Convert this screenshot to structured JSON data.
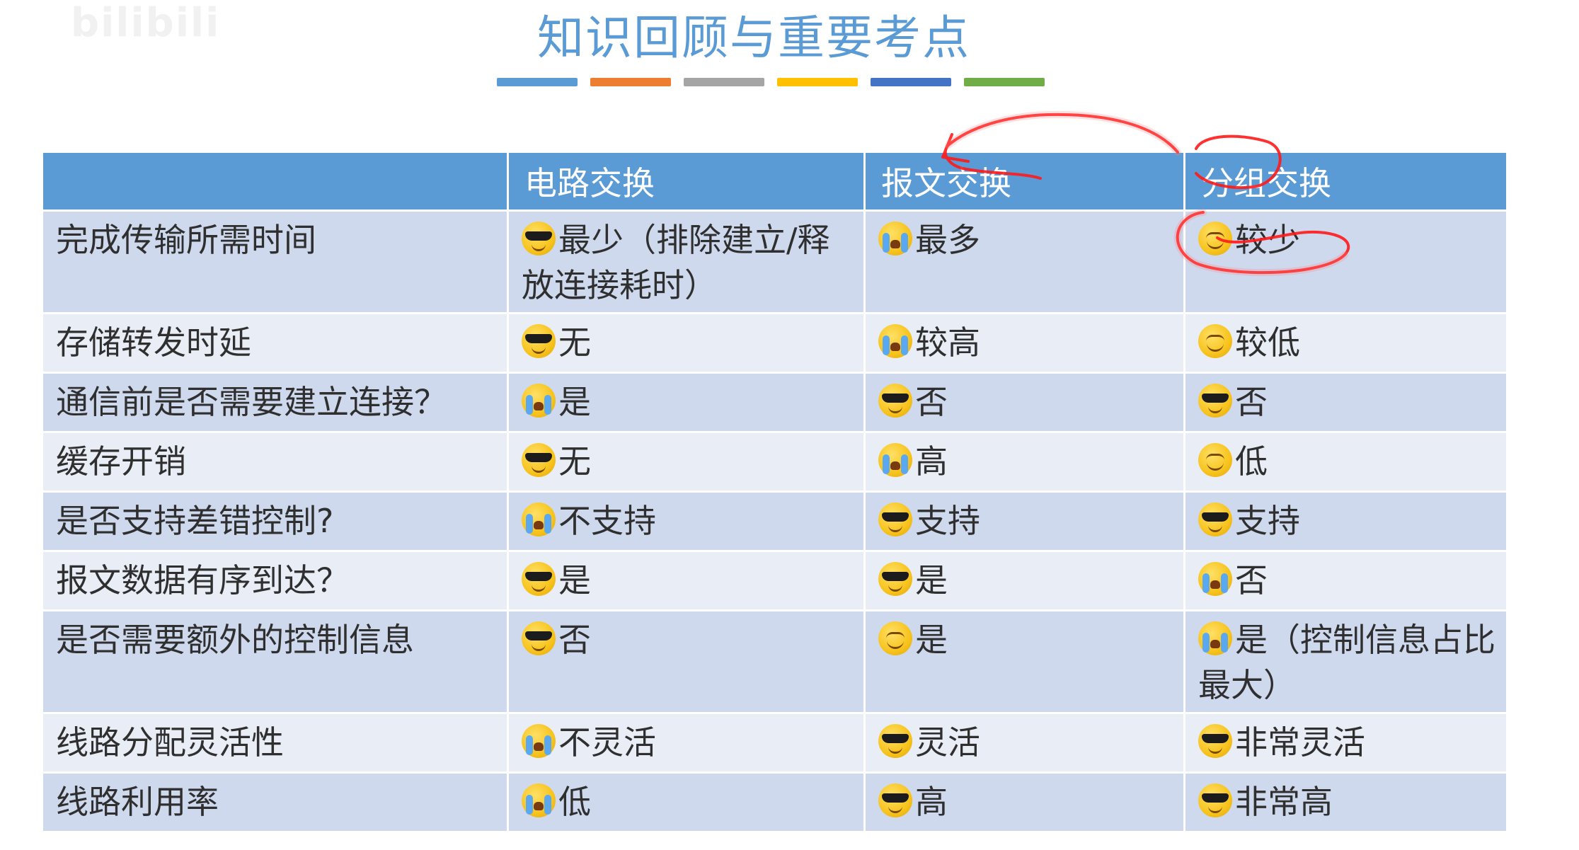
{
  "watermark": "bilibili",
  "title": "知识回顾与重要考点",
  "colors": {
    "title": "#5b9bd5",
    "header_bg": "#5b9bd5",
    "row_odd": "#cfd9ee",
    "row_even": "#e9edf6",
    "annotation_red": "#ff1a1a",
    "bars": [
      "#5b9bd5",
      "#ed7d31",
      "#a5a5a5",
      "#ffc000",
      "#4472c4",
      "#70ad47"
    ]
  },
  "table": {
    "headers": [
      "",
      "电路交换",
      "报文交换",
      "分组交换"
    ],
    "rows": [
      {
        "label": "完成传输所需时间",
        "cells": [
          {
            "icon": "cool-face-icon",
            "text": "最少（排除建立/释放连接耗时）"
          },
          {
            "icon": "crying-face-icon",
            "text": "最多"
          },
          {
            "icon": "smiling-face-icon",
            "text": "较少"
          }
        ]
      },
      {
        "label": "存储转发时延",
        "cells": [
          {
            "icon": "cool-face-icon",
            "text": "无"
          },
          {
            "icon": "crying-face-icon",
            "text": "较高"
          },
          {
            "icon": "smiling-face-icon",
            "text": "较低"
          }
        ]
      },
      {
        "label": "通信前是否需要建立连接？",
        "cells": [
          {
            "icon": "crying-face-icon",
            "text": "是"
          },
          {
            "icon": "cool-face-icon",
            "text": "否"
          },
          {
            "icon": "cool-face-icon",
            "text": "否"
          }
        ]
      },
      {
        "label": "缓存开销",
        "cells": [
          {
            "icon": "cool-face-icon",
            "text": "无"
          },
          {
            "icon": "crying-face-icon",
            "text": "高"
          },
          {
            "icon": "smiling-face-icon",
            "text": "低"
          }
        ]
      },
      {
        "label": "是否支持差错控制?",
        "cells": [
          {
            "icon": "crying-face-icon",
            "text": "不支持"
          },
          {
            "icon": "cool-face-icon",
            "text": "支持"
          },
          {
            "icon": "cool-face-icon",
            "text": "支持"
          }
        ]
      },
      {
        "label": "报文数据有序到达？",
        "cells": [
          {
            "icon": "cool-face-icon",
            "text": "是"
          },
          {
            "icon": "cool-face-icon",
            "text": "是"
          },
          {
            "icon": "crying-face-icon",
            "text": "否"
          }
        ]
      },
      {
        "label": "是否需要额外的控制信息",
        "cells": [
          {
            "icon": "cool-face-icon",
            "text": "否"
          },
          {
            "icon": "smiling-face-icon",
            "text": "是"
          },
          {
            "icon": "crying-face-icon",
            "text": "是（控制信息占比最大）"
          }
        ]
      },
      {
        "label": "线路分配灵活性",
        "cells": [
          {
            "icon": "crying-face-icon",
            "text": "不灵活"
          },
          {
            "icon": "cool-face-icon",
            "text": "灵活"
          },
          {
            "icon": "cool-face-icon",
            "text": "非常灵活"
          }
        ]
      },
      {
        "label": "线路利用率",
        "cells": [
          {
            "icon": "crying-face-icon",
            "text": "低"
          },
          {
            "icon": "cool-face-icon",
            "text": "高"
          },
          {
            "icon": "cool-face-icon",
            "text": "非常高"
          }
        ]
      }
    ]
  }
}
